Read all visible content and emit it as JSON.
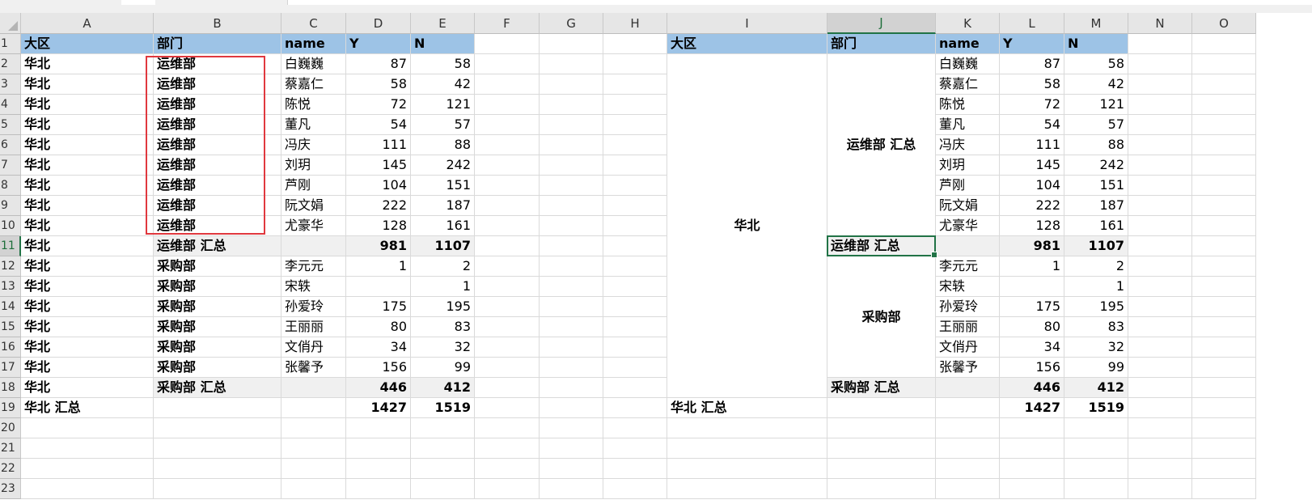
{
  "columns": [
    "A",
    "B",
    "C",
    "D",
    "E",
    "F",
    "G",
    "H",
    "I",
    "J",
    "K",
    "L",
    "M",
    "N",
    "O"
  ],
  "row_numbers": [
    "1",
    "2",
    "3",
    "4",
    "5",
    "6",
    "7",
    "8",
    "9",
    "10",
    "11",
    "12",
    "13",
    "14",
    "15",
    "16",
    "17",
    "18",
    "19",
    "20",
    "21",
    "22",
    "23"
  ],
  "selected_column": "J",
  "selected_row": "11",
  "left_table": {
    "headers": [
      "大区",
      "部门",
      "name",
      "Y",
      "N"
    ],
    "rows": [
      [
        "华北",
        "运维部",
        "白巍巍",
        "87",
        "58"
      ],
      [
        "华北",
        "运维部",
        "蔡嘉仁",
        "58",
        "42"
      ],
      [
        "华北",
        "运维部",
        "陈悦",
        "72",
        "121"
      ],
      [
        "华北",
        "运维部",
        "董凡",
        "54",
        "57"
      ],
      [
        "华北",
        "运维部",
        "冯庆",
        "111",
        "88"
      ],
      [
        "华北",
        "运维部",
        "刘玥",
        "145",
        "242"
      ],
      [
        "华北",
        "运维部",
        "芦刚",
        "104",
        "151"
      ],
      [
        "华北",
        "运维部",
        "阮文娟",
        "222",
        "187"
      ],
      [
        "华北",
        "运维部",
        "尤豪华",
        "128",
        "161"
      ],
      [
        "华北",
        "运维部 汇总",
        "",
        "981",
        "1107"
      ],
      [
        "华北",
        "采购部",
        "李元元",
        "1",
        "2"
      ],
      [
        "华北",
        "采购部",
        "宋轶",
        "",
        "1"
      ],
      [
        "华北",
        "采购部",
        "孙爱玲",
        "175",
        "195"
      ],
      [
        "华北",
        "采购部",
        "王丽丽",
        "80",
        "83"
      ],
      [
        "华北",
        "采购部",
        "文俏丹",
        "34",
        "32"
      ],
      [
        "华北",
        "采购部",
        "张馨予",
        "156",
        "99"
      ],
      [
        "华北",
        "采购部 汇总",
        "",
        "446",
        "412"
      ],
      [
        "华北 汇总",
        "",
        "",
        "1427",
        "1519"
      ]
    ]
  },
  "right_table": {
    "headers": [
      "大区",
      "部门",
      "name",
      "Y",
      "N"
    ],
    "region_merged": "华北",
    "dept1_merged": "运维部 汇总",
    "dept1_subtotal": {
      "label": "运维部 汇总",
      "Y": "981",
      "N": "1107"
    },
    "dept2_merged": "采购部",
    "dept2_subtotal": {
      "label": "采购部 汇总",
      "Y": "446",
      "N": "412"
    },
    "grand_total": {
      "label": "华北 汇总",
      "Y": "1427",
      "N": "1519"
    },
    "dept1_rows": [
      [
        "白巍巍",
        "87",
        "58"
      ],
      [
        "蔡嘉仁",
        "58",
        "42"
      ],
      [
        "陈悦",
        "72",
        "121"
      ],
      [
        "董凡",
        "54",
        "57"
      ],
      [
        "冯庆",
        "111",
        "88"
      ],
      [
        "刘玥",
        "145",
        "242"
      ],
      [
        "芦刚",
        "104",
        "151"
      ],
      [
        "阮文娟",
        "222",
        "187"
      ],
      [
        "尤豪华",
        "128",
        "161"
      ]
    ],
    "dept2_rows": [
      [
        "李元元",
        "1",
        "2"
      ],
      [
        "宋轶",
        "",
        "1"
      ],
      [
        "孙爱玲",
        "175",
        "195"
      ],
      [
        "王丽丽",
        "80",
        "83"
      ],
      [
        "文俏丹",
        "34",
        "32"
      ],
      [
        "张馨予",
        "156",
        "99"
      ]
    ]
  },
  "colors": {
    "header_fill": "#9dc3e6",
    "subtotal_fill": "#f0f0f0",
    "highlight_border": "#e0383e",
    "selection_border": "#217346"
  }
}
